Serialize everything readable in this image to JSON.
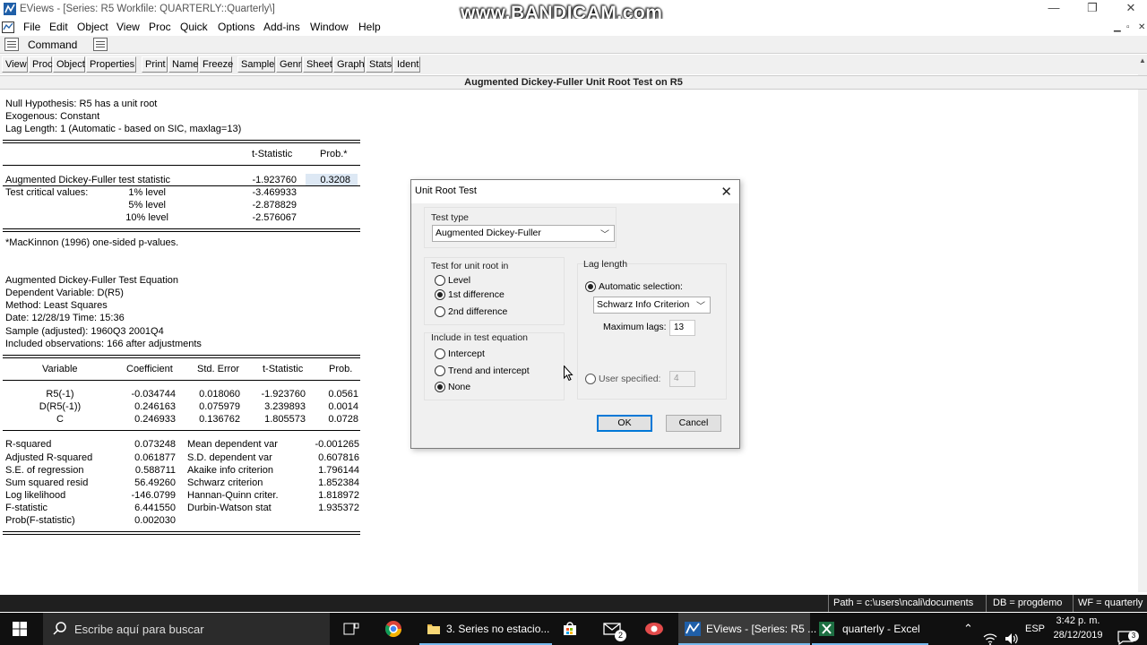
{
  "window": {
    "title": "EViews - [Series: R5   Workfile: QUARTERLY::Quarterly\\]",
    "watermark": "www.BANDICAM.com",
    "min": "—",
    "max": "❐",
    "close": "✕"
  },
  "menu": [
    "File",
    "Edit",
    "Object",
    "View",
    "Proc",
    "Quick",
    "Options",
    "Add-ins",
    "Window",
    "Help"
  ],
  "command": {
    "label": "Command"
  },
  "toolbar": [
    "View",
    "Proc",
    "Object",
    "Properties",
    "Print",
    "Name",
    "Freeze",
    "Sample",
    "Genr",
    "Sheet",
    "Graph",
    "Stats",
    "Ident"
  ],
  "output": {
    "header": "Augmented Dickey-Fuller Unit Root Test on R5",
    "null_hypothesis": "Null Hypothesis: R5 has a unit root",
    "exogenous": "Exogenous: Constant",
    "lag_length": "Lag Length: 1 (Automatic - based on SIC, maxlag=13)",
    "col_tstat": "t-Statistic",
    "col_prob": "Prob.*",
    "adf_label": "Augmented Dickey-Fuller test statistic",
    "adf_t": "-1.923760",
    "adf_p": "0.3208",
    "crit_label": "Test critical values:",
    "crit": [
      {
        "level": "1% level",
        "value": "-3.469933"
      },
      {
        "level": "5% level",
        "value": "-2.878829"
      },
      {
        "level": "10% level",
        "value": "-2.576067"
      }
    ],
    "footnote": "*MacKinnon (1996) one-sided p-values.",
    "eq_title": "Augmented Dickey-Fuller Test Equation",
    "dep_var": "Dependent Variable: D(R5)",
    "method": "Method: Least Squares",
    "date": "Date: 12/28/19   Time: 15:36",
    "sample": "Sample (adjusted): 1960Q3 2001Q4",
    "obs": "Included observations: 166 after adjustments",
    "coef_headers": [
      "Variable",
      "Coefficient",
      "Std. Error",
      "t-Statistic",
      "Prob."
    ],
    "coef_rows": [
      [
        "R5(-1)",
        "-0.034744",
        "0.018060",
        "-1.923760",
        "0.0561"
      ],
      [
        "D(R5(-1))",
        "0.246163",
        "0.075979",
        "3.239893",
        "0.0014"
      ],
      [
        "C",
        "0.246933",
        "0.136762",
        "1.805573",
        "0.0728"
      ]
    ],
    "stats_left": [
      [
        "R-squared",
        "0.073248"
      ],
      [
        "Adjusted R-squared",
        "0.061877"
      ],
      [
        "S.E. of regression",
        "0.588711"
      ],
      [
        "Sum squared resid",
        "56.49260"
      ],
      [
        "Log likelihood",
        "-146.0799"
      ],
      [
        "F-statistic",
        "6.441550"
      ],
      [
        "Prob(F-statistic)",
        "0.002030"
      ]
    ],
    "stats_right": [
      [
        "Mean dependent var",
        "-0.001265"
      ],
      [
        "S.D. dependent var",
        "0.607816"
      ],
      [
        "Akaike info criterion",
        "1.796144"
      ],
      [
        "Schwarz criterion",
        "1.852384"
      ],
      [
        "Hannan-Quinn criter.",
        "1.818972"
      ],
      [
        "Durbin-Watson stat",
        "1.935372"
      ]
    ]
  },
  "dialog": {
    "title": "Unit Root Test",
    "close": "✕",
    "test_type_label": "Test type",
    "test_type_value": "Augmented Dickey-Fuller",
    "unit_root_label": "Test for unit root in",
    "unit_root_options": [
      "Level",
      "1st difference",
      "2nd difference"
    ],
    "unit_root_selected": "1st difference",
    "include_label": "Include in test equation",
    "include_options": [
      "Intercept",
      "Trend and intercept",
      "None"
    ],
    "include_selected": "None",
    "lag_label": "Lag length",
    "auto_label": "Automatic selection:",
    "criterion_value": "Schwarz Info Criterion",
    "max_lags_label": "Maximum lags:",
    "max_lags_value": "13",
    "user_label": "User specified:",
    "user_value": "4",
    "ok": "OK",
    "cancel": "Cancel"
  },
  "statusbar": {
    "path": "Path = c:\\users\\ncali\\documents",
    "db": "DB = progdemo",
    "wf": "WF = quarterly"
  },
  "taskbar": {
    "search_placeholder": "Escribe aquí para buscar",
    "items": [
      {
        "label": "3. Series no estacio...",
        "icon": "folder-icon"
      },
      {
        "label": "EViews - [Series: R5 ...",
        "icon": "eviews-icon"
      },
      {
        "label": "quarterly - Excel",
        "icon": "excel-icon"
      }
    ],
    "badge": "2",
    "lang": "ESP",
    "time": "3:42 p. m.",
    "date": "28/12/2019",
    "notif": "3"
  }
}
